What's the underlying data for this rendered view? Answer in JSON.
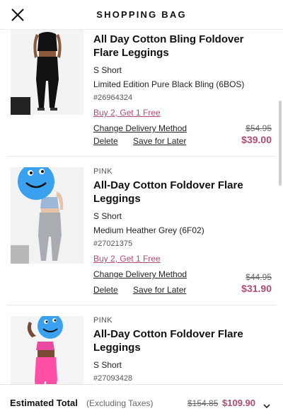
{
  "header": {
    "title": "SHOPPING BAG",
    "close_icon": "close-icon"
  },
  "items": [
    {
      "brand": "",
      "name": "All Day Cotton Bling Foldover Flare Leggings",
      "size": "S Short",
      "color": "Limited Edition Pure Black Bling (6BOS)",
      "sku": "#26964324",
      "promo": "Buy 2, Get 1 Free",
      "delivery": "Change Delivery Method",
      "delete": "Delete",
      "save": "Save for Later",
      "price_original": "$54.95",
      "price_sale": "$39.00"
    },
    {
      "brand": "PINK",
      "name": "All-Day Cotton Foldover Flare Leggings",
      "size": "S Short",
      "color": "Medium Heather Grey (6F02)",
      "sku": "#27021375",
      "promo": "Buy 2, Get 1 Free",
      "delivery": "Change Delivery Method",
      "delete": "Delete",
      "save": "Save for Later",
      "price_original": "$44.95",
      "price_sale": "$31.90"
    },
    {
      "brand": "PINK",
      "name": "All-Day Cotton Foldover Flare Leggings",
      "size": "S Short",
      "sku": "#27093428"
    }
  ],
  "footer": {
    "label": "Estimated Total",
    "tax_note": "(Excluding Taxes)",
    "total_original": "$154.85",
    "total_sale": "$109.90",
    "expand_icon": "chevron-down-icon"
  },
  "colors": {
    "accent": "#b04a73",
    "text": "#111111",
    "muted": "#666666"
  }
}
